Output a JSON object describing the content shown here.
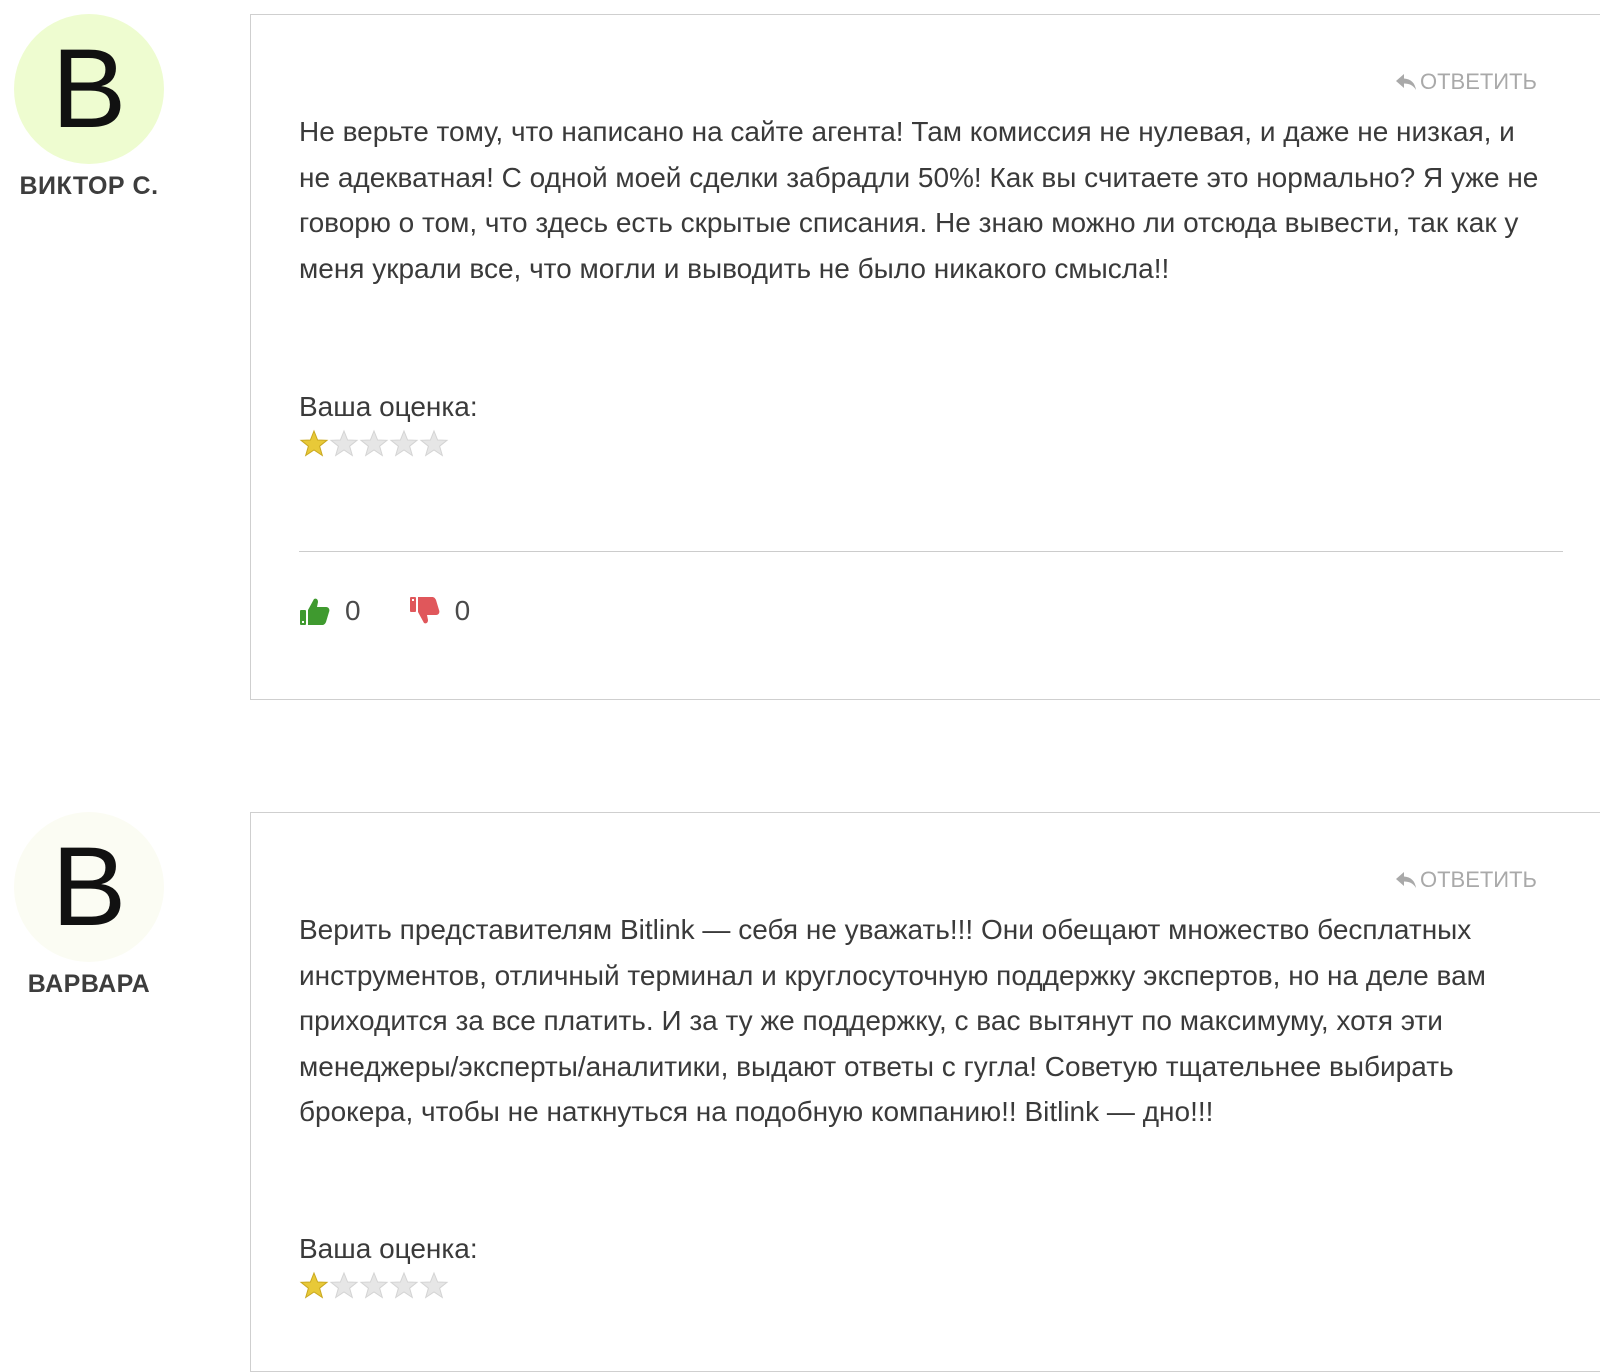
{
  "comments": [
    {
      "avatar_letter": "В",
      "avatar_color": "#eefcd0",
      "author": "ВИКТОР С.",
      "reply_label": "ОТВЕТИТЬ",
      "text": "Не верьте тому, что написано на сайте агента! Там комиссия не нулевая, и даже не низкая, и не адекватная! С одной моей сделки забрадли 50%! Как вы считаете это нормально? Я уже не говорю о том, что здесь есть скрытые списания. Не знаю можно ли отсюда вывести, так как у меня украли все, что могли и выводить не было никакого смысла!!",
      "rating_label": "Ваша оценка:",
      "rating": 1,
      "rating_max": 5,
      "likes": "0",
      "dislikes": "0"
    },
    {
      "avatar_letter": "В",
      "avatar_color": "#fbfcf3",
      "author": "ВАРВАРА",
      "reply_label": "ОТВЕТИТЬ",
      "text": "Верить представителям Bitlink — себя не уважать!!! Они обещают множество бесплатных инструментов, отличный терминал и круглосуточную поддержку экспертов, но на деле вам приходится за все платить. И за ту же поддержку, с вас вытянут по максимуму, хотя эти менеджеры/эксперты/аналитики, выдают ответы с гугла! Советую тщательнее выбирать брокера, чтобы не наткнуться на подобную компанию!! Bitlink — дно!!!",
      "rating_label": "Ваша оценка:",
      "rating": 1,
      "rating_max": 5
    }
  ],
  "colors": {
    "like": "#3f9a2f",
    "dislike": "#e0575b",
    "star_filled": "#e8c938",
    "star_empty": "#e6e6e6",
    "border": "#cfcfcf",
    "muted": "#a9a9a9"
  }
}
